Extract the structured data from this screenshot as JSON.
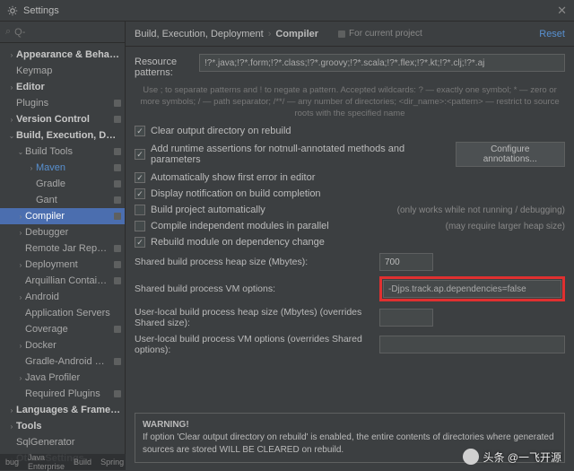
{
  "window": {
    "title": "Settings",
    "reset": "Reset"
  },
  "search": {
    "placeholder": "Q-"
  },
  "sidebar": [
    {
      "label": "Appearance & Behavior",
      "chev": ">",
      "bold": true,
      "d": 0
    },
    {
      "label": "Keymap",
      "d": 0
    },
    {
      "label": "Editor",
      "chev": ">",
      "bold": true,
      "d": 0
    },
    {
      "label": "Plugins",
      "d": 0,
      "badge": true
    },
    {
      "label": "Version Control",
      "chev": ">",
      "bold": true,
      "d": 0,
      "badge": true
    },
    {
      "label": "Build, Execution, Deployment",
      "chev": "v",
      "bold": true,
      "d": 0
    },
    {
      "label": "Build Tools",
      "chev": "v",
      "d": 1,
      "badge": true
    },
    {
      "label": "Maven",
      "chev": ">",
      "d": 2,
      "badge": true,
      "blue": true
    },
    {
      "label": "Gradle",
      "d": 2,
      "badge": true
    },
    {
      "label": "Gant",
      "d": 2,
      "badge": true
    },
    {
      "label": "Compiler",
      "chev": ">",
      "d": 1,
      "badge": true,
      "selected": true
    },
    {
      "label": "Debugger",
      "chev": ">",
      "d": 1
    },
    {
      "label": "Remote Jar Repositories",
      "d": 1,
      "badge": true
    },
    {
      "label": "Deployment",
      "chev": ">",
      "d": 1,
      "badge": true
    },
    {
      "label": "Arquillian Containers",
      "d": 1,
      "badge": true
    },
    {
      "label": "Android",
      "chev": ">",
      "d": 1
    },
    {
      "label": "Application Servers",
      "d": 1
    },
    {
      "label": "Coverage",
      "d": 1,
      "badge": true
    },
    {
      "label": "Docker",
      "chev": ">",
      "d": 1
    },
    {
      "label": "Gradle-Android Compiler",
      "d": 1,
      "badge": true
    },
    {
      "label": "Java Profiler",
      "chev": ">",
      "d": 1
    },
    {
      "label": "Required Plugins",
      "d": 1,
      "badge": true
    },
    {
      "label": "Languages & Frameworks",
      "chev": ">",
      "bold": true,
      "d": 0
    },
    {
      "label": "Tools",
      "chev": ">",
      "bold": true,
      "d": 0
    },
    {
      "label": "SqlGenerator",
      "d": 0
    },
    {
      "label": "Other Settings",
      "chev": ">",
      "bold": true,
      "d": 0
    }
  ],
  "breadcrumb": {
    "a": "Build, Execution, Deployment",
    "b": "Compiler",
    "for": "For current project"
  },
  "resource": {
    "label": "Resource patterns:",
    "value": "!?*.java;!?*.form;!?*.class;!?*.groovy;!?*.scala;!?*.flex;!?*.kt;!?*.clj;!?*.aj",
    "hint": "Use ; to separate patterns and ! to negate a pattern. Accepted wildcards: ? — exactly one symbol; * — zero or more symbols; / — path separator; /**/ — any number of directories; <dir_name>:<pattern> — restrict to source roots with the specified name"
  },
  "checks": [
    {
      "label": "Clear output directory on rebuild",
      "on": true
    },
    {
      "label": "Add runtime assertions for notnull-annotated methods and parameters",
      "on": true,
      "btn": "Configure annotations..."
    },
    {
      "label": "Automatically show first error in editor",
      "on": true
    },
    {
      "label": "Display notification on build completion",
      "on": true
    },
    {
      "label": "Build project automatically",
      "on": false,
      "aux": "(only works while not running / debugging)"
    },
    {
      "label": "Compile independent modules in parallel",
      "on": false,
      "aux": "(may require larger heap size)"
    },
    {
      "label": "Rebuild module on dependency change",
      "on": true
    }
  ],
  "fields": [
    {
      "label": "Shared build process heap size (Mbytes):",
      "value": "700",
      "type": "num"
    },
    {
      "label": "Shared build process VM options:",
      "value": "-Djps.track.ap.dependencies=false",
      "type": "text",
      "highlight": true
    },
    {
      "label": "User-local build process heap size (Mbytes) (overrides Shared size):",
      "value": "",
      "type": "num"
    },
    {
      "label": "User-local build process VM options (overrides Shared options):",
      "value": "",
      "type": "text"
    }
  ],
  "warning": {
    "title": "WARNING!",
    "body": "If option 'Clear output directory on rebuild' is enabled, the entire contents of directories where generated sources are stored WILL BE CLEARED on rebuild."
  },
  "watermark": "头条 @一飞开源",
  "bottombar": {
    "a": "bug",
    "b": "Java Enterprise",
    "c": "Build",
    "d": "Spring"
  }
}
